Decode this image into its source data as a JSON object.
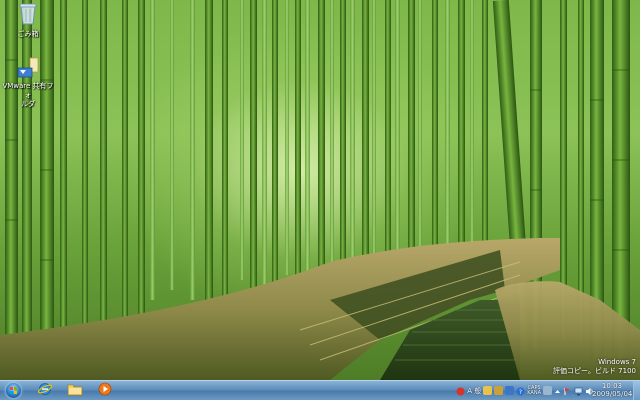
{
  "desktop": {
    "recycle_bin": {
      "label": "ごみ箱",
      "icon": "recycle-bin-icon"
    },
    "vmware_shared": {
      "label_line1": "VMware 共有フォ",
      "label_line2": "ルダ",
      "icon": "shared-folder-icon"
    }
  },
  "watermark": {
    "line1": "Windows 7",
    "line2": "評価コピー。ビルド 7100"
  },
  "taskbar": {
    "start": {
      "icon": "windows-start-orb"
    },
    "pinned": [
      {
        "name": "internet-explorer",
        "icon": "ie-icon"
      },
      {
        "name": "windows-explorer",
        "icon": "folder-icon"
      },
      {
        "name": "media-player",
        "icon": "media-player-icon"
      }
    ],
    "tray": {
      "ime_mode": "A 般",
      "caps": "CAPS",
      "kana": "KANA"
    },
    "clock": {
      "time": "10:03",
      "date": "2009/05/04"
    }
  },
  "colors": {
    "taskbar": "#5d8dbb",
    "bamboo": "#3f7a1f",
    "foliage": "#8cc257"
  }
}
